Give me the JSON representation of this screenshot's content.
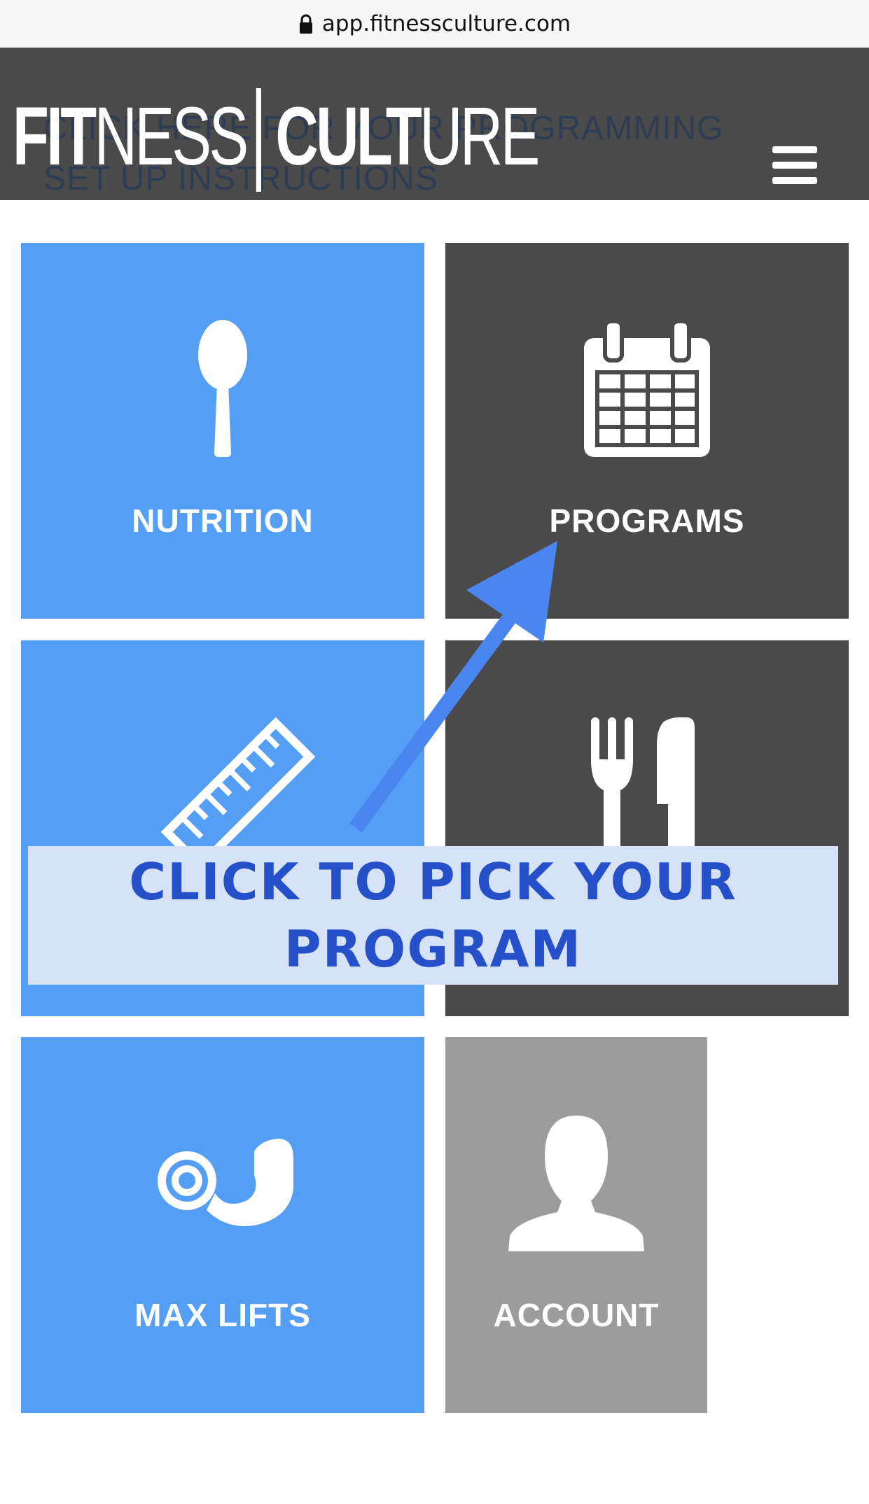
{
  "browser": {
    "url": "app.fitnessculture.com"
  },
  "header": {
    "logo_left": "FIT",
    "logo_mid": "NESS",
    "logo_right": "CULT",
    "logo_end": "URE",
    "behind_link": "CLICK HERE FOR YOUR PROGRAMMING SET UP INSTRUCTIONS"
  },
  "tiles": {
    "nutrition": {
      "label": "NUTRITION",
      "icon": "spoon-icon"
    },
    "programs": {
      "label": "PROGRAMS",
      "icon": "calendar-icon"
    },
    "measurements": {
      "label": "",
      "icon": "ruler-icon"
    },
    "meals": {
      "label": "",
      "icon": "fork-knife-icon"
    },
    "max_lifts": {
      "label": "MAX LIFTS",
      "icon": "arm-weight-icon"
    },
    "account": {
      "label": "ACCOUNT",
      "icon": "user-icon"
    }
  },
  "annotation": {
    "line1": "CLICK TO PICK YOUR",
    "line2": "PROGRAM"
  },
  "colors": {
    "blue_tile": "#559ef5",
    "dark_tile": "#4a4a4a",
    "grey_tile": "#9c9c9c",
    "arrow": "#4a86f0",
    "callout_bg": "#d6e2f8",
    "callout_text": "#2550c9"
  }
}
